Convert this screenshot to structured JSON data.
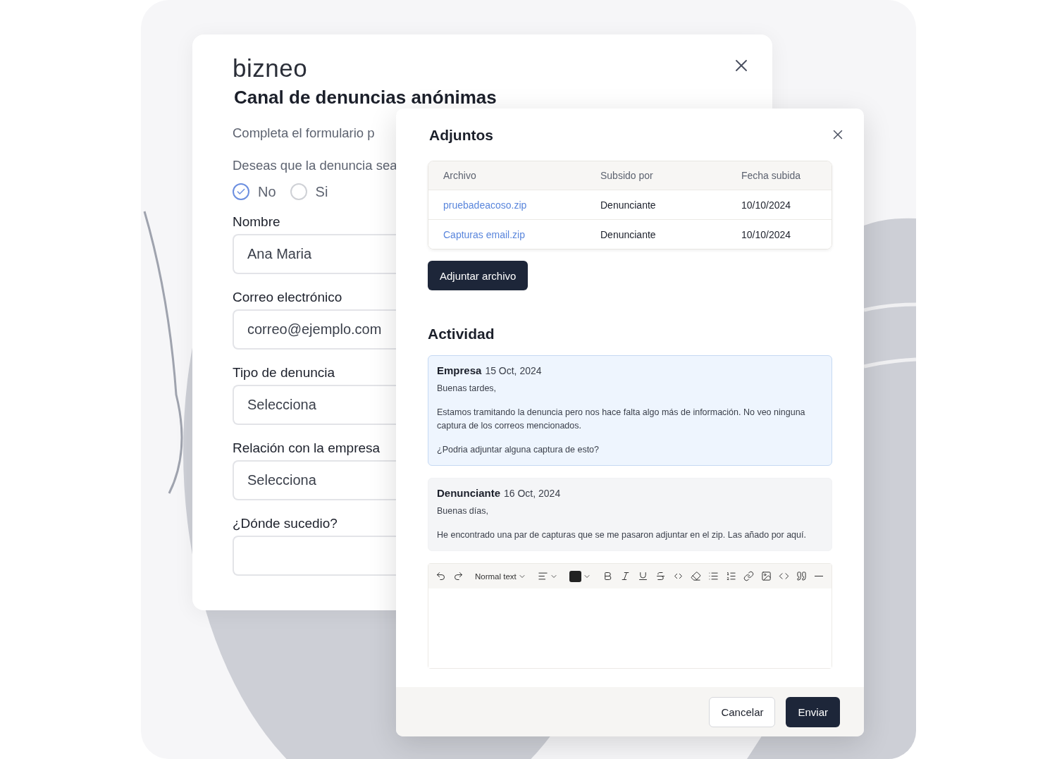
{
  "back_dialog": {
    "logo": "bizneo",
    "title": "Canal de denuncias anónimas",
    "intro": "Completa el formulario p",
    "question": "Deseas que la denuncia sea",
    "radios": [
      {
        "label": "No",
        "selected": true
      },
      {
        "label": "Si",
        "selected": false
      }
    ],
    "fields": [
      {
        "label": "Nombre",
        "value": "Ana Maria"
      },
      {
        "label": "Correo electrónico",
        "value": "correo@ejemplo.com"
      },
      {
        "label": "Tipo de denuncia",
        "value": "Selecciona"
      },
      {
        "label": "Relación con la empresa",
        "value": "Selecciona"
      },
      {
        "label": "¿Dónde sucedio?"
      }
    ]
  },
  "attachments_dialog": {
    "title": "Adjuntos",
    "table": {
      "columns": [
        "Archivo",
        "Subsido por",
        "Fecha subida"
      ],
      "rows": [
        [
          "pruebadeacoso.zip",
          "Denunciante",
          "10/10/2024"
        ],
        [
          "Capturas email.zip",
          "Denunciante",
          "10/10/2024"
        ]
      ]
    },
    "attach_button": "Adjuntar archivo",
    "activity_title": "Actividad",
    "messages": [
      {
        "author": "Empresa",
        "date": "15 Oct, 2024",
        "highlighted": true,
        "paragraphs": [
          "Buenas tardes,",
          "Estamos tramitando la denuncia pero nos hace falta algo más de información. No veo ninguna captura de los correos mencionados.",
          "¿Podria adjuntar alguna captura de esto?"
        ]
      },
      {
        "author": "Denunciante",
        "date": "16 Oct, 2024",
        "highlighted": false,
        "paragraphs": [
          "Buenas días,",
          "He encontrado una par de capturas que se me pasaron adjuntar en el zip. Las añado por aquí."
        ]
      }
    ],
    "editor": {
      "block_style": "Normal text"
    },
    "buttons": [
      "Cancelar",
      "Enviar"
    ]
  }
}
